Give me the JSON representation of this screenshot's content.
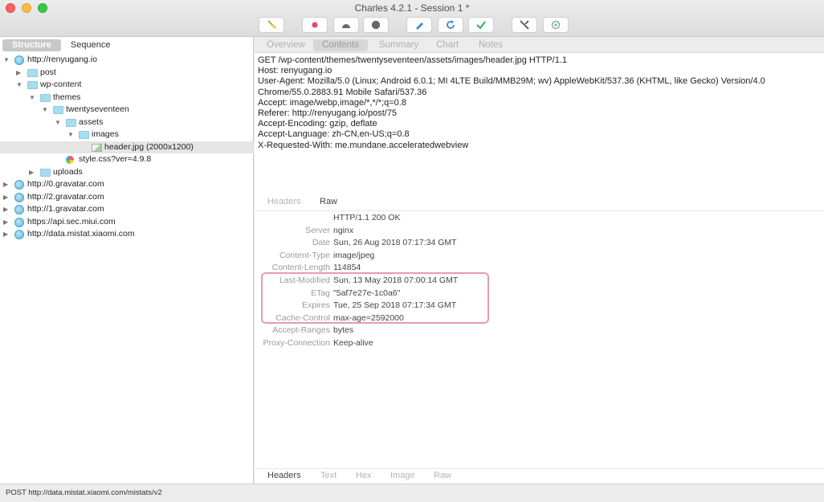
{
  "window": {
    "title": "Charles 4.2.1 - Session 1 *"
  },
  "toolbar": {
    "buttons": [
      {
        "name": "broom-icon"
      },
      {
        "name": "record-icon"
      },
      {
        "name": "throttle-icon"
      },
      {
        "name": "breakpoint-icon"
      },
      {
        "name": "compose-icon"
      },
      {
        "name": "repeat-icon"
      },
      {
        "name": "validate-icon"
      },
      {
        "name": "tools-icon"
      },
      {
        "name": "settings-icon"
      }
    ]
  },
  "left": {
    "segments": [
      "Structure",
      "Sequence"
    ],
    "tree": [
      {
        "label": "http://renyugang.io",
        "icon": "globe",
        "level": 0,
        "arrow": "down"
      },
      {
        "label": "post",
        "icon": "folder",
        "level": 1,
        "arrow": "right"
      },
      {
        "label": "wp-content",
        "icon": "folder",
        "level": 1,
        "arrow": "down"
      },
      {
        "label": "themes",
        "icon": "folder",
        "level": 2,
        "arrow": "down"
      },
      {
        "label": "twentyseventeen",
        "icon": "folder",
        "level": 3,
        "arrow": "down"
      },
      {
        "label": "assets",
        "icon": "folder",
        "level": 4,
        "arrow": "down"
      },
      {
        "label": "images",
        "icon": "folder",
        "level": 5,
        "arrow": "down"
      },
      {
        "label": "header.jpg (2000x1200)",
        "icon": "image",
        "level": 6,
        "arrow": "",
        "selected": true
      },
      {
        "label": "style.css?ver=4.9.8",
        "icon": "css",
        "level": 4,
        "arrow": ""
      },
      {
        "label": "uploads",
        "icon": "folder",
        "level": 2,
        "arrow": "right"
      },
      {
        "label": "http://0.gravatar.com",
        "icon": "globe",
        "level": 0,
        "arrow": "right"
      },
      {
        "label": "http://2.gravatar.com",
        "icon": "globe",
        "level": 0,
        "arrow": "right"
      },
      {
        "label": "http://1.gravatar.com",
        "icon": "globe",
        "level": 0,
        "arrow": "right"
      },
      {
        "label": "https://api.sec.miui.com",
        "icon": "globe",
        "level": 0,
        "arrow": "right"
      },
      {
        "label": "http://data.mistat.xiaomi.com",
        "icon": "globe",
        "level": 0,
        "arrow": "right"
      }
    ]
  },
  "right": {
    "tabs": [
      "Overview",
      "Contents",
      "Summary",
      "Chart",
      "Notes"
    ],
    "active_tab": "Contents",
    "request_text": "GET /wp-content/themes/twentyseventeen/assets/images/header.jpg HTTP/1.1\nHost: renyugang.io\nUser-Agent: Mozilla/5.0 (Linux; Android 6.0.1; MI 4LTE Build/MMB29M; wv) AppleWebKit/537.36 (KHTML, like Gecko) Version/4.0\nChrome/55.0.2883.91 Mobile Safari/537.36\nAccept: image/webp,image/*,*/*;q=0.8\nReferer: http://renyugang.io/post/75\nAccept-Encoding: gzip, deflate\nAccept-Language: zh-CN,en-US;q=0.8\nX-Requested-With: me.mundane.acceleratedwebview",
    "request_subtabs": [
      "Headers",
      "Raw"
    ],
    "response_headers": [
      {
        "key": "",
        "value": "HTTP/1.1 200 OK"
      },
      {
        "key": "Server",
        "value": "nginx"
      },
      {
        "key": "Date",
        "value": "Sun, 26 Aug 2018 07:17:34 GMT"
      },
      {
        "key": "Content-Type",
        "value": "image/jpeg"
      },
      {
        "key": "Content-Length",
        "value": "114854"
      },
      {
        "key": "Last-Modified",
        "value": "Sun, 13 May 2018 07:00:14 GMT"
      },
      {
        "key": "ETag",
        "value": "\"5af7e27e-1c0a6\""
      },
      {
        "key": "Expires",
        "value": "Tue, 25 Sep 2018 07:17:34 GMT"
      },
      {
        "key": "Cache-Control",
        "value": "max-age=2592000"
      },
      {
        "key": "Accept-Ranges",
        "value": "bytes"
      },
      {
        "key": "Proxy-Connection",
        "value": "Keep-alive"
      }
    ],
    "response_subtabs": [
      "Headers",
      "Text",
      "Hex",
      "Image",
      "Raw"
    ]
  },
  "status": {
    "text": "POST http://data.mistat.xiaomi.com/mistats/v2"
  },
  "colors": {
    "highlight": "#e79ab4",
    "folder": "#a8dcef"
  }
}
